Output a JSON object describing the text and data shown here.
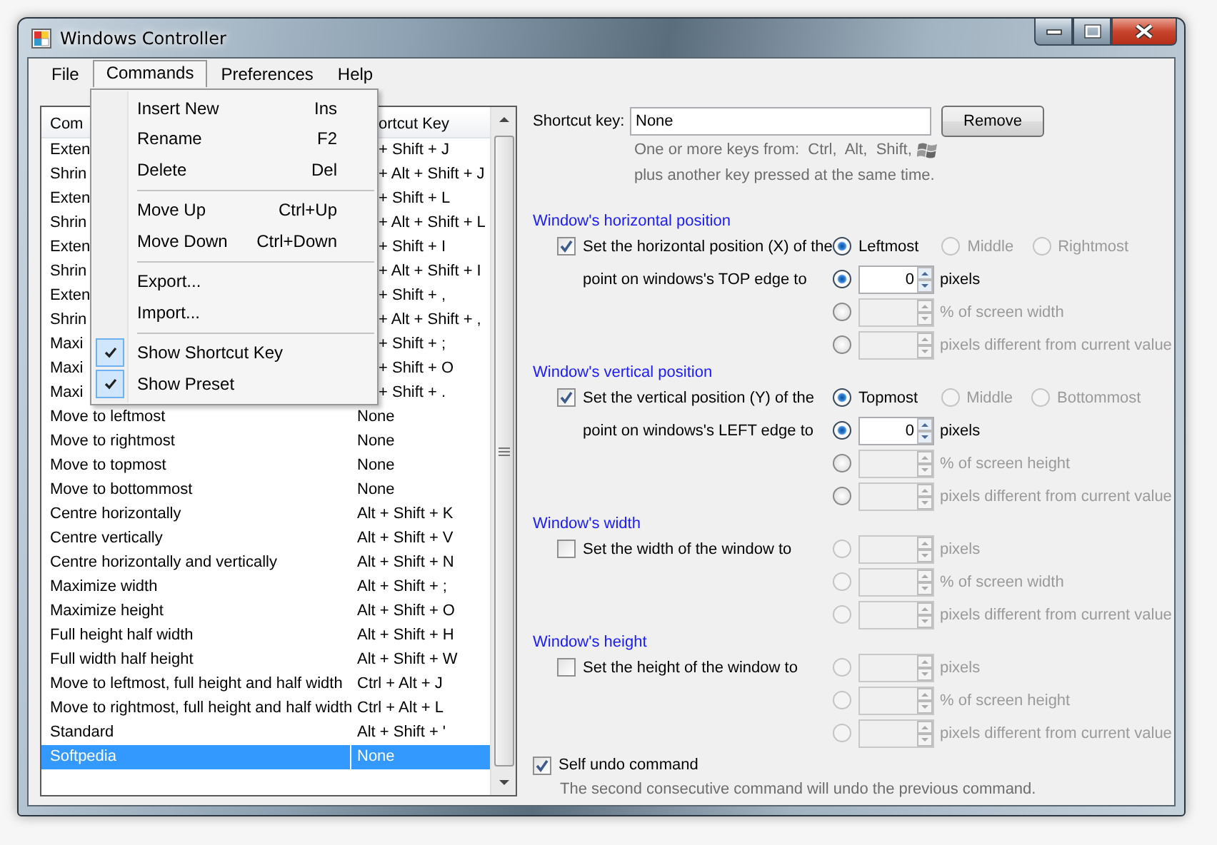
{
  "window": {
    "title": "Windows Controller"
  },
  "menu_bar": [
    {
      "label": "File",
      "selected": false
    },
    {
      "label": "Commands",
      "selected": true
    },
    {
      "label": "Preferences",
      "selected": false
    },
    {
      "label": "Help",
      "selected": false
    }
  ],
  "commands_menu": [
    {
      "kind": "item",
      "label": "Insert New",
      "shortcut": "Ins"
    },
    {
      "kind": "item",
      "label": "Rename",
      "shortcut": "F2"
    },
    {
      "kind": "item",
      "label": "Delete",
      "shortcut": "Del"
    },
    {
      "kind": "separator"
    },
    {
      "kind": "item",
      "label": "Move Up",
      "shortcut": "Ctrl+Up"
    },
    {
      "kind": "item",
      "label": "Move Down",
      "shortcut": "Ctrl+Down"
    },
    {
      "kind": "separator"
    },
    {
      "kind": "item",
      "label": "Export..."
    },
    {
      "kind": "item",
      "label": "Import..."
    },
    {
      "kind": "separator"
    },
    {
      "kind": "check",
      "label": "Show Shortcut Key",
      "checked": true
    },
    {
      "kind": "check",
      "label": "Show Preset",
      "checked": true
    }
  ],
  "list": {
    "columns": [
      "Com",
      "ortcut Key"
    ],
    "rows": [
      {
        "name": "Exten",
        "shortcut": "+ Shift + J",
        "selected": false
      },
      {
        "name": "Shrin",
        "shortcut": "+ Alt + Shift + J",
        "selected": false
      },
      {
        "name": "Exten",
        "shortcut": "+ Shift + L",
        "selected": false
      },
      {
        "name": "Shrin",
        "shortcut": "+ Alt + Shift + L",
        "selected": false
      },
      {
        "name": "Exten",
        "shortcut": "+ Shift + I",
        "selected": false
      },
      {
        "name": "Shrin",
        "shortcut": "+ Alt + Shift + I",
        "selected": false
      },
      {
        "name": "Exten",
        "shortcut": "+ Shift + ,",
        "selected": false
      },
      {
        "name": "Shrin",
        "shortcut": "+ Alt + Shift + ,",
        "selected": false
      },
      {
        "name": "Maxi",
        "shortcut": "+ Shift + ;",
        "selected": false
      },
      {
        "name": "Maxi",
        "shortcut": "+ Shift + O",
        "selected": false
      },
      {
        "name": "Maxi",
        "shortcut": "+ Shift + .",
        "selected": false
      },
      {
        "name": "Move to leftmost",
        "shortcut": "None",
        "selected": false
      },
      {
        "name": "Move to rightmost",
        "shortcut": "None",
        "selected": false
      },
      {
        "name": "Move to topmost",
        "shortcut": "None",
        "selected": false
      },
      {
        "name": "Move to bottommost",
        "shortcut": "None",
        "selected": false
      },
      {
        "name": "Centre horizontally",
        "shortcut": "Alt + Shift + K",
        "selected": false
      },
      {
        "name": "Centre vertically",
        "shortcut": "Alt + Shift + V",
        "selected": false
      },
      {
        "name": "Centre horizontally and vertically",
        "shortcut": "Alt + Shift + N",
        "selected": false
      },
      {
        "name": "Maximize width",
        "shortcut": "Alt + Shift + ;",
        "selected": false
      },
      {
        "name": "Maximize height",
        "shortcut": "Alt + Shift + O",
        "selected": false
      },
      {
        "name": "Full height half width",
        "shortcut": "Alt + Shift + H",
        "selected": false
      },
      {
        "name": "Full width half height",
        "shortcut": "Alt + Shift + W",
        "selected": false
      },
      {
        "name": "Move to leftmost, full height and half width",
        "shortcut": "Ctrl + Alt + J",
        "selected": false
      },
      {
        "name": "Move to rightmost, full height and half width",
        "shortcut": "Ctrl + Alt + L",
        "selected": false
      },
      {
        "name": "Standard",
        "shortcut": "Alt + Shift + '",
        "selected": false
      },
      {
        "name": "Softpedia",
        "shortcut": "None",
        "selected": true
      }
    ]
  },
  "shortcut": {
    "label": "Shortcut key:",
    "value": "None",
    "button": "Remove",
    "hint": [
      "One or more keys from:  Ctrl,  Alt,  Shift,",
      "plus another key pressed at the same time."
    ]
  },
  "sections": [
    {
      "title": "Window's horizontal position",
      "checked": true,
      "label": [
        "Set the horizontal position (X) of the",
        "point on windows's TOP edge to"
      ],
      "anchors": [
        {
          "label": "Leftmost",
          "selected": true,
          "disabled": false
        },
        {
          "label": "Middle",
          "selected": false,
          "disabled": true
        },
        {
          "label": "Rightmost",
          "selected": false,
          "disabled": true
        }
      ],
      "options": [
        {
          "unit": "pixels",
          "value": "0",
          "selected": true,
          "disabled": false
        },
        {
          "unit": "% of screen width",
          "selected": false,
          "disabled": true
        },
        {
          "unit": "pixels different from current value",
          "selected": false,
          "disabled": true
        }
      ]
    },
    {
      "title": "Window's vertical position",
      "checked": true,
      "label": [
        "Set the vertical position (Y) of the",
        "point on windows's LEFT edge to"
      ],
      "anchors": [
        {
          "label": "Topmost",
          "selected": true,
          "disabled": false
        },
        {
          "label": "Middle",
          "selected": false,
          "disabled": true
        },
        {
          "label": "Bottommost",
          "selected": false,
          "disabled": true
        }
      ],
      "options": [
        {
          "unit": "pixels",
          "value": "0",
          "selected": true,
          "disabled": false
        },
        {
          "unit": "% of screen height",
          "selected": false,
          "disabled": true
        },
        {
          "unit": "pixels different from current value",
          "selected": false,
          "disabled": true
        }
      ]
    },
    {
      "title": "Window's width",
      "checked": false,
      "label": [
        "Set the width of the window to"
      ],
      "options": [
        {
          "unit": "pixels",
          "selected": false,
          "disabled": true
        },
        {
          "unit": "% of screen width",
          "selected": false,
          "disabled": true
        },
        {
          "unit": "pixels different from current value",
          "selected": false,
          "disabled": true
        }
      ]
    },
    {
      "title": "Window's height",
      "checked": false,
      "label": [
        "Set the height of the window to"
      ],
      "options": [
        {
          "unit": "pixels",
          "selected": false,
          "disabled": true
        },
        {
          "unit": "% of screen height",
          "selected": false,
          "disabled": true
        },
        {
          "unit": "pixels different from current value",
          "selected": false,
          "disabled": true
        }
      ]
    }
  ],
  "self_undo": {
    "label": "Self undo command",
    "checked": true,
    "note": "The second consecutive command will undo the previous command."
  }
}
